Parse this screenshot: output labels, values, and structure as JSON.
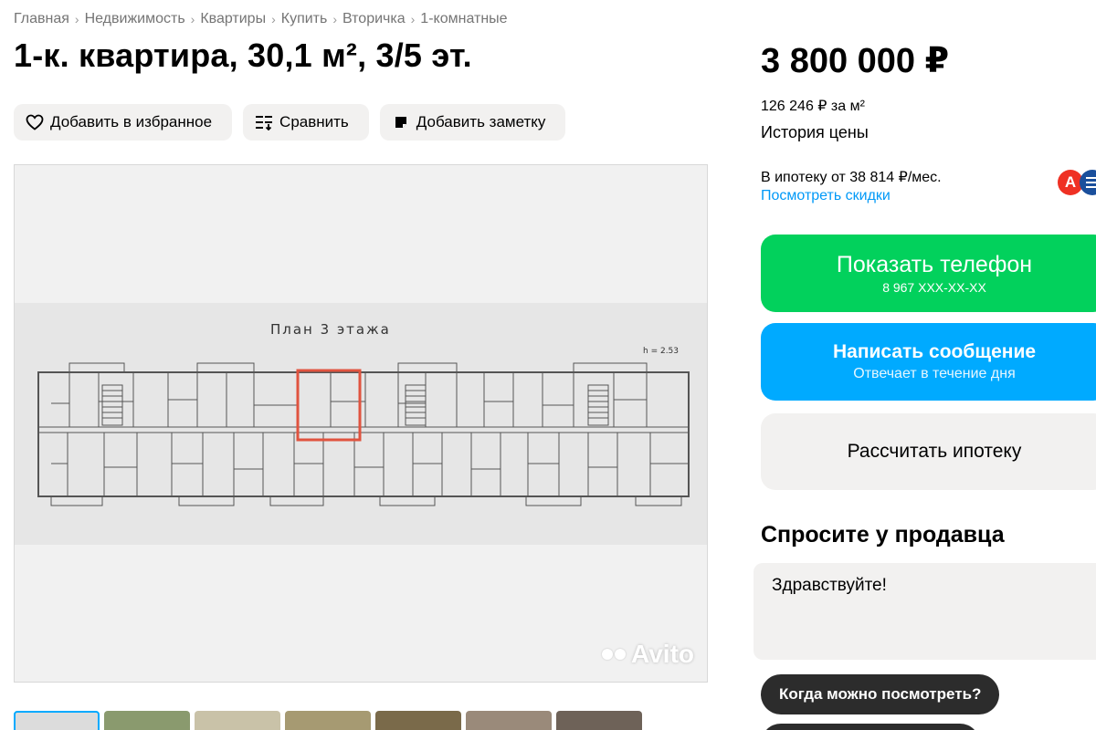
{
  "breadcrumb": [
    "Главная",
    "Недвижимость",
    "Квартиры",
    "Купить",
    "Вторичка",
    "1-комнатные"
  ],
  "title": "1-к. квартира, 30,1 м², 3/5 эт.",
  "actions": {
    "favorite": "Добавить в избранное",
    "compare": "Сравнить",
    "note": "Добавить заметку"
  },
  "photo": {
    "plan_title": "План 3 этажа",
    "plan_height": "h = 2.53",
    "watermark": "Avito"
  },
  "thumbnails_count": 7,
  "price": {
    "value": "3 800 000 ₽",
    "per_meter": "126 246 ₽ за м²",
    "history": "История цены"
  },
  "mortgage": {
    "text": "В ипотеку от 38 814 ₽/мес.",
    "discounts": "Посмотреть скидки",
    "bank_letter": "А"
  },
  "buttons": {
    "phone_label": "Показать телефон",
    "phone_number": "8 967 XXX-XX-XX",
    "message_label": "Написать сообщение",
    "message_sub": "Отвечает в течение дня",
    "calc_label": "Рассчитать ипотеку"
  },
  "ask": {
    "title": "Спросите у продавца",
    "message": "Здравствуйте!",
    "chip_1": "Когда можно посмотреть?"
  },
  "colors": {
    "green": "#02d15c",
    "blue": "#00aaff",
    "link": "#0099f7",
    "plan_highlight": "#e0533f"
  }
}
